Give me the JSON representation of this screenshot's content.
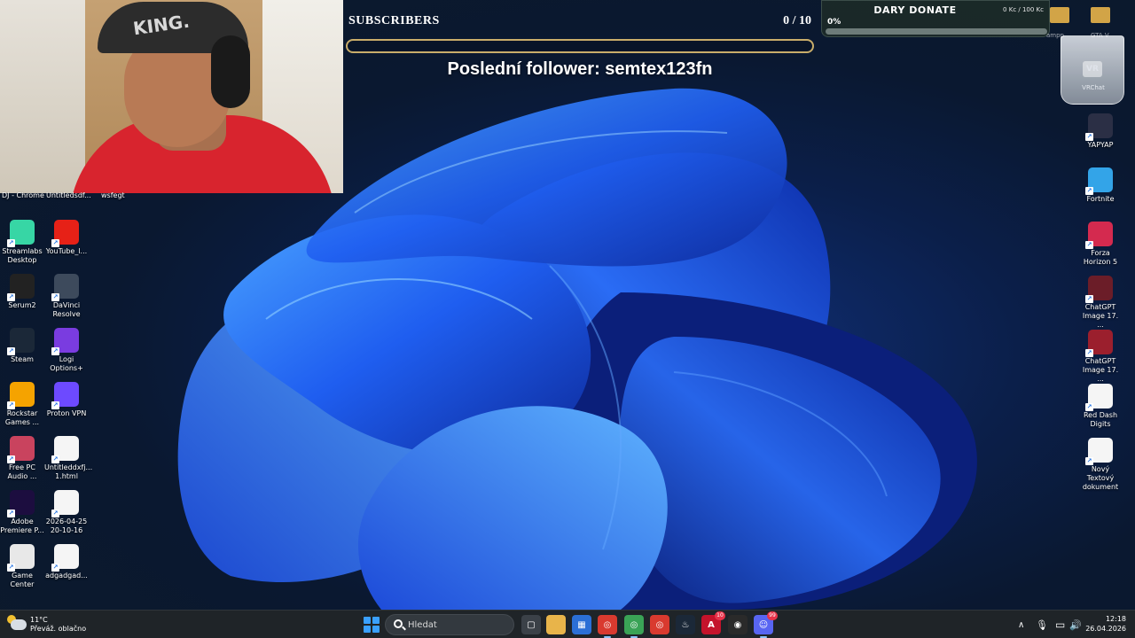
{
  "overlay": {
    "subscribers": {
      "title": "SUBSCRIBERS",
      "count": "0 / 10",
      "progress": 0.0
    },
    "last_follower": "Poslední follower: semtex123fn",
    "donate": {
      "title": "DARY DONATE",
      "goal": "0 Kc / 100 Kc",
      "percent_label": "0%",
      "progress": 0.0
    }
  },
  "webcam": {
    "cap_text": "KING."
  },
  "top_row_labels": [
    "DJ - Chrome",
    "Untitledsdf...",
    "wsfegt"
  ],
  "desktop": {
    "left_icons": [
      {
        "label": "Streamlabs\nDesktop",
        "icon": "streamlabs-icon",
        "color": "#37d6a5"
      },
      {
        "label": "YouTube_l...",
        "icon": "youtube-icon",
        "color": "#e62117"
      },
      {
        "label": "Serum2",
        "icon": "serum-icon",
        "color": "#222222"
      },
      {
        "label": "DaVinci\nResolve",
        "icon": "davinci-icon",
        "color": "#3d4a5c"
      },
      {
        "label": "Steam",
        "icon": "steam-icon",
        "color": "#1b2838"
      },
      {
        "label": "Logi\nOptions+",
        "icon": "logi-icon",
        "color": "#7a3ce0"
      },
      {
        "label": "Rockstar\nGames ...",
        "icon": "rockstar-icon",
        "color": "#f5a300"
      },
      {
        "label": "Proton VPN",
        "icon": "protonvpn-icon",
        "color": "#6d4aff"
      },
      {
        "label": "Free PC\nAudio ...",
        "icon": "audio-icon",
        "color": "#c9435e"
      },
      {
        "label": "Untitleddxfj...\n1.html",
        "icon": "file-icon",
        "color": "#f5f5f5"
      },
      {
        "label": "Adobe\nPremiere P...",
        "icon": "premiere-icon",
        "color": "#1c0d3f"
      },
      {
        "label": "2026-04-25\n20-10-16",
        "icon": "video-file-icon",
        "color": "#f5f5f5"
      },
      {
        "label": "Game Center",
        "icon": "game-center-icon",
        "color": "#e8e8e8"
      },
      {
        "label": "adgadgad...",
        "icon": "video-file-icon",
        "color": "#f5f5f5"
      }
    ],
    "right_icons": [
      {
        "label": "YAPYAP",
        "icon": "yapyap-icon",
        "color": "#2b2f45"
      },
      {
        "label": "Fortnite",
        "icon": "fortnite-icon",
        "color": "#33a4e8"
      },
      {
        "label": "Forza\nHorizon 5",
        "icon": "forza-icon",
        "color": "#d42a4f"
      },
      {
        "label": "ChatGPT\nImage 17. ...",
        "icon": "image-file-icon",
        "color": "#6b1d28"
      },
      {
        "label": "ChatGPT\nImage 17. ...",
        "icon": "image-file-icon",
        "color": "#9b1f2d"
      },
      {
        "label": "Red Dash\nDigits",
        "icon": "video-file-icon",
        "color": "#f5f5f5"
      },
      {
        "label": "Nový Textový\ndokument",
        "icon": "text-file-icon",
        "color": "#f5f5f5"
      }
    ],
    "recycle": {
      "label": "VRChat",
      "vr_text": "VR"
    },
    "top_right_labels": [
      "ampp",
      "GTA V"
    ]
  },
  "taskbar": {
    "weather": {
      "temp": "11°C",
      "desc": "Převáž. oblačno"
    },
    "search_placeholder": "Hledat",
    "apps": [
      {
        "name": "task-view-icon",
        "glyph": "▢",
        "color": "#3b4148",
        "badge": ""
      },
      {
        "name": "file-explorer-icon",
        "glyph": "",
        "color": "#e8b44a",
        "badge": ""
      },
      {
        "name": "store-icon",
        "glyph": "▦",
        "color": "#2b6fd6",
        "badge": ""
      },
      {
        "name": "chrome-icon",
        "glyph": "◎",
        "color": "#d93a2f",
        "badge": ""
      },
      {
        "name": "chrome-profile-icon",
        "glyph": "◎",
        "color": "#3aa356",
        "badge": ""
      },
      {
        "name": "chrome-profile-2-icon",
        "glyph": "◎",
        "color": "#d93a2f",
        "badge": ""
      },
      {
        "name": "steam-icon",
        "glyph": "♨",
        "color": "#1b2838",
        "badge": ""
      },
      {
        "name": "adobe-icon",
        "glyph": "A",
        "color": "#c4132b",
        "badge": "10"
      },
      {
        "name": "obs-icon",
        "glyph": "◉",
        "color": "#2a2a2a",
        "badge": ""
      },
      {
        "name": "discord-icon",
        "glyph": "☺",
        "color": "#5865f2",
        "badge": "99"
      }
    ],
    "tray": {
      "chevron": "∧",
      "mic": "🎙",
      "monitor": "▭",
      "speaker": "🔊"
    },
    "time": "12:18",
    "date": "26.04.2026"
  }
}
